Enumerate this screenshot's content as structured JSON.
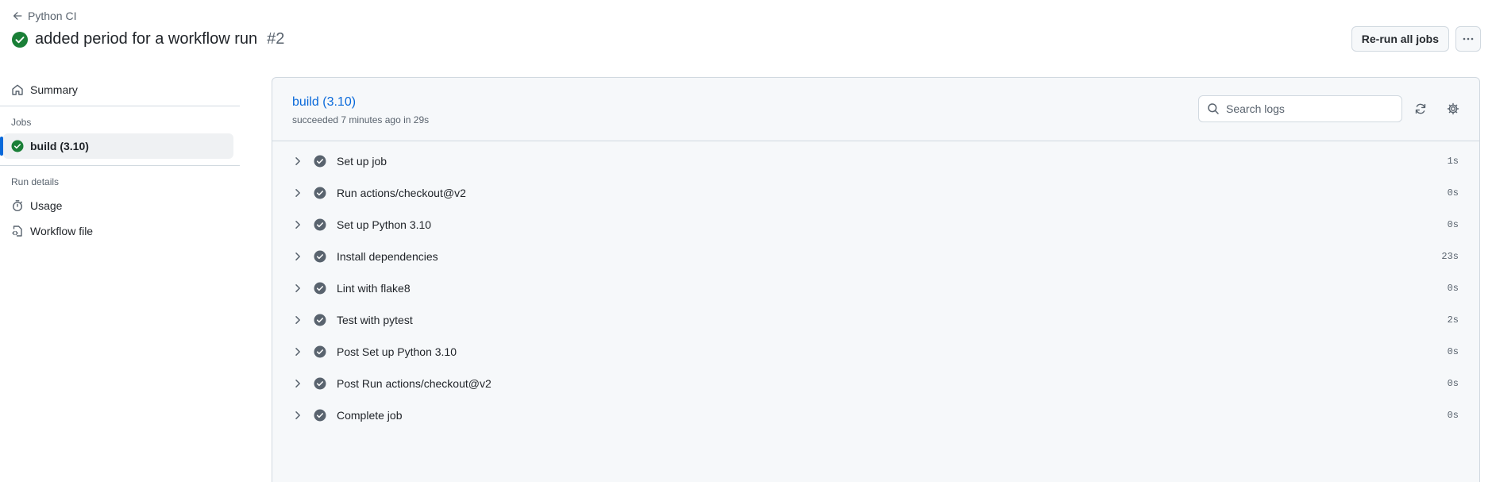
{
  "header": {
    "back_label": "Python CI",
    "title": "added period for a workflow run",
    "run_number": "#2",
    "rerun_label": "Re-run all jobs"
  },
  "sidebar": {
    "summary_label": "Summary",
    "jobs_heading": "Jobs",
    "job_label": "build (3.10)",
    "run_details_heading": "Run details",
    "usage_label": "Usage",
    "workflow_file_label": "Workflow file"
  },
  "panel": {
    "job_name": "build (3.10)",
    "job_meta": "succeeded 7 minutes ago in 29s",
    "search_placeholder": "Search logs",
    "steps": [
      {
        "label": "Set up job",
        "duration": "1s"
      },
      {
        "label": "Run actions/checkout@v2",
        "duration": "0s"
      },
      {
        "label": "Set up Python 3.10",
        "duration": "0s"
      },
      {
        "label": "Install dependencies",
        "duration": "23s"
      },
      {
        "label": "Lint with flake8",
        "duration": "0s"
      },
      {
        "label": "Test with pytest",
        "duration": "2s"
      },
      {
        "label": "Post Set up Python 3.10",
        "duration": "0s"
      },
      {
        "label": "Post Run actions/checkout@v2",
        "duration": "0s"
      },
      {
        "label": "Complete job",
        "duration": "0s"
      }
    ]
  },
  "colors": {
    "success": "#1a7f37",
    "accent": "#0969da",
    "step_check": "#59636e"
  },
  "icons": {
    "back": "arrow-left-icon",
    "status": "check-circle-fill-icon",
    "more": "kebab-horizontal-icon",
    "summary": "home-icon",
    "usage": "stopwatch-icon",
    "workflow_file": "file-code-icon",
    "search": "search-icon",
    "refresh": "sync-icon",
    "settings": "gear-icon",
    "step_expand": "chevron-right-icon",
    "step_status": "check-circle-fill-icon"
  }
}
